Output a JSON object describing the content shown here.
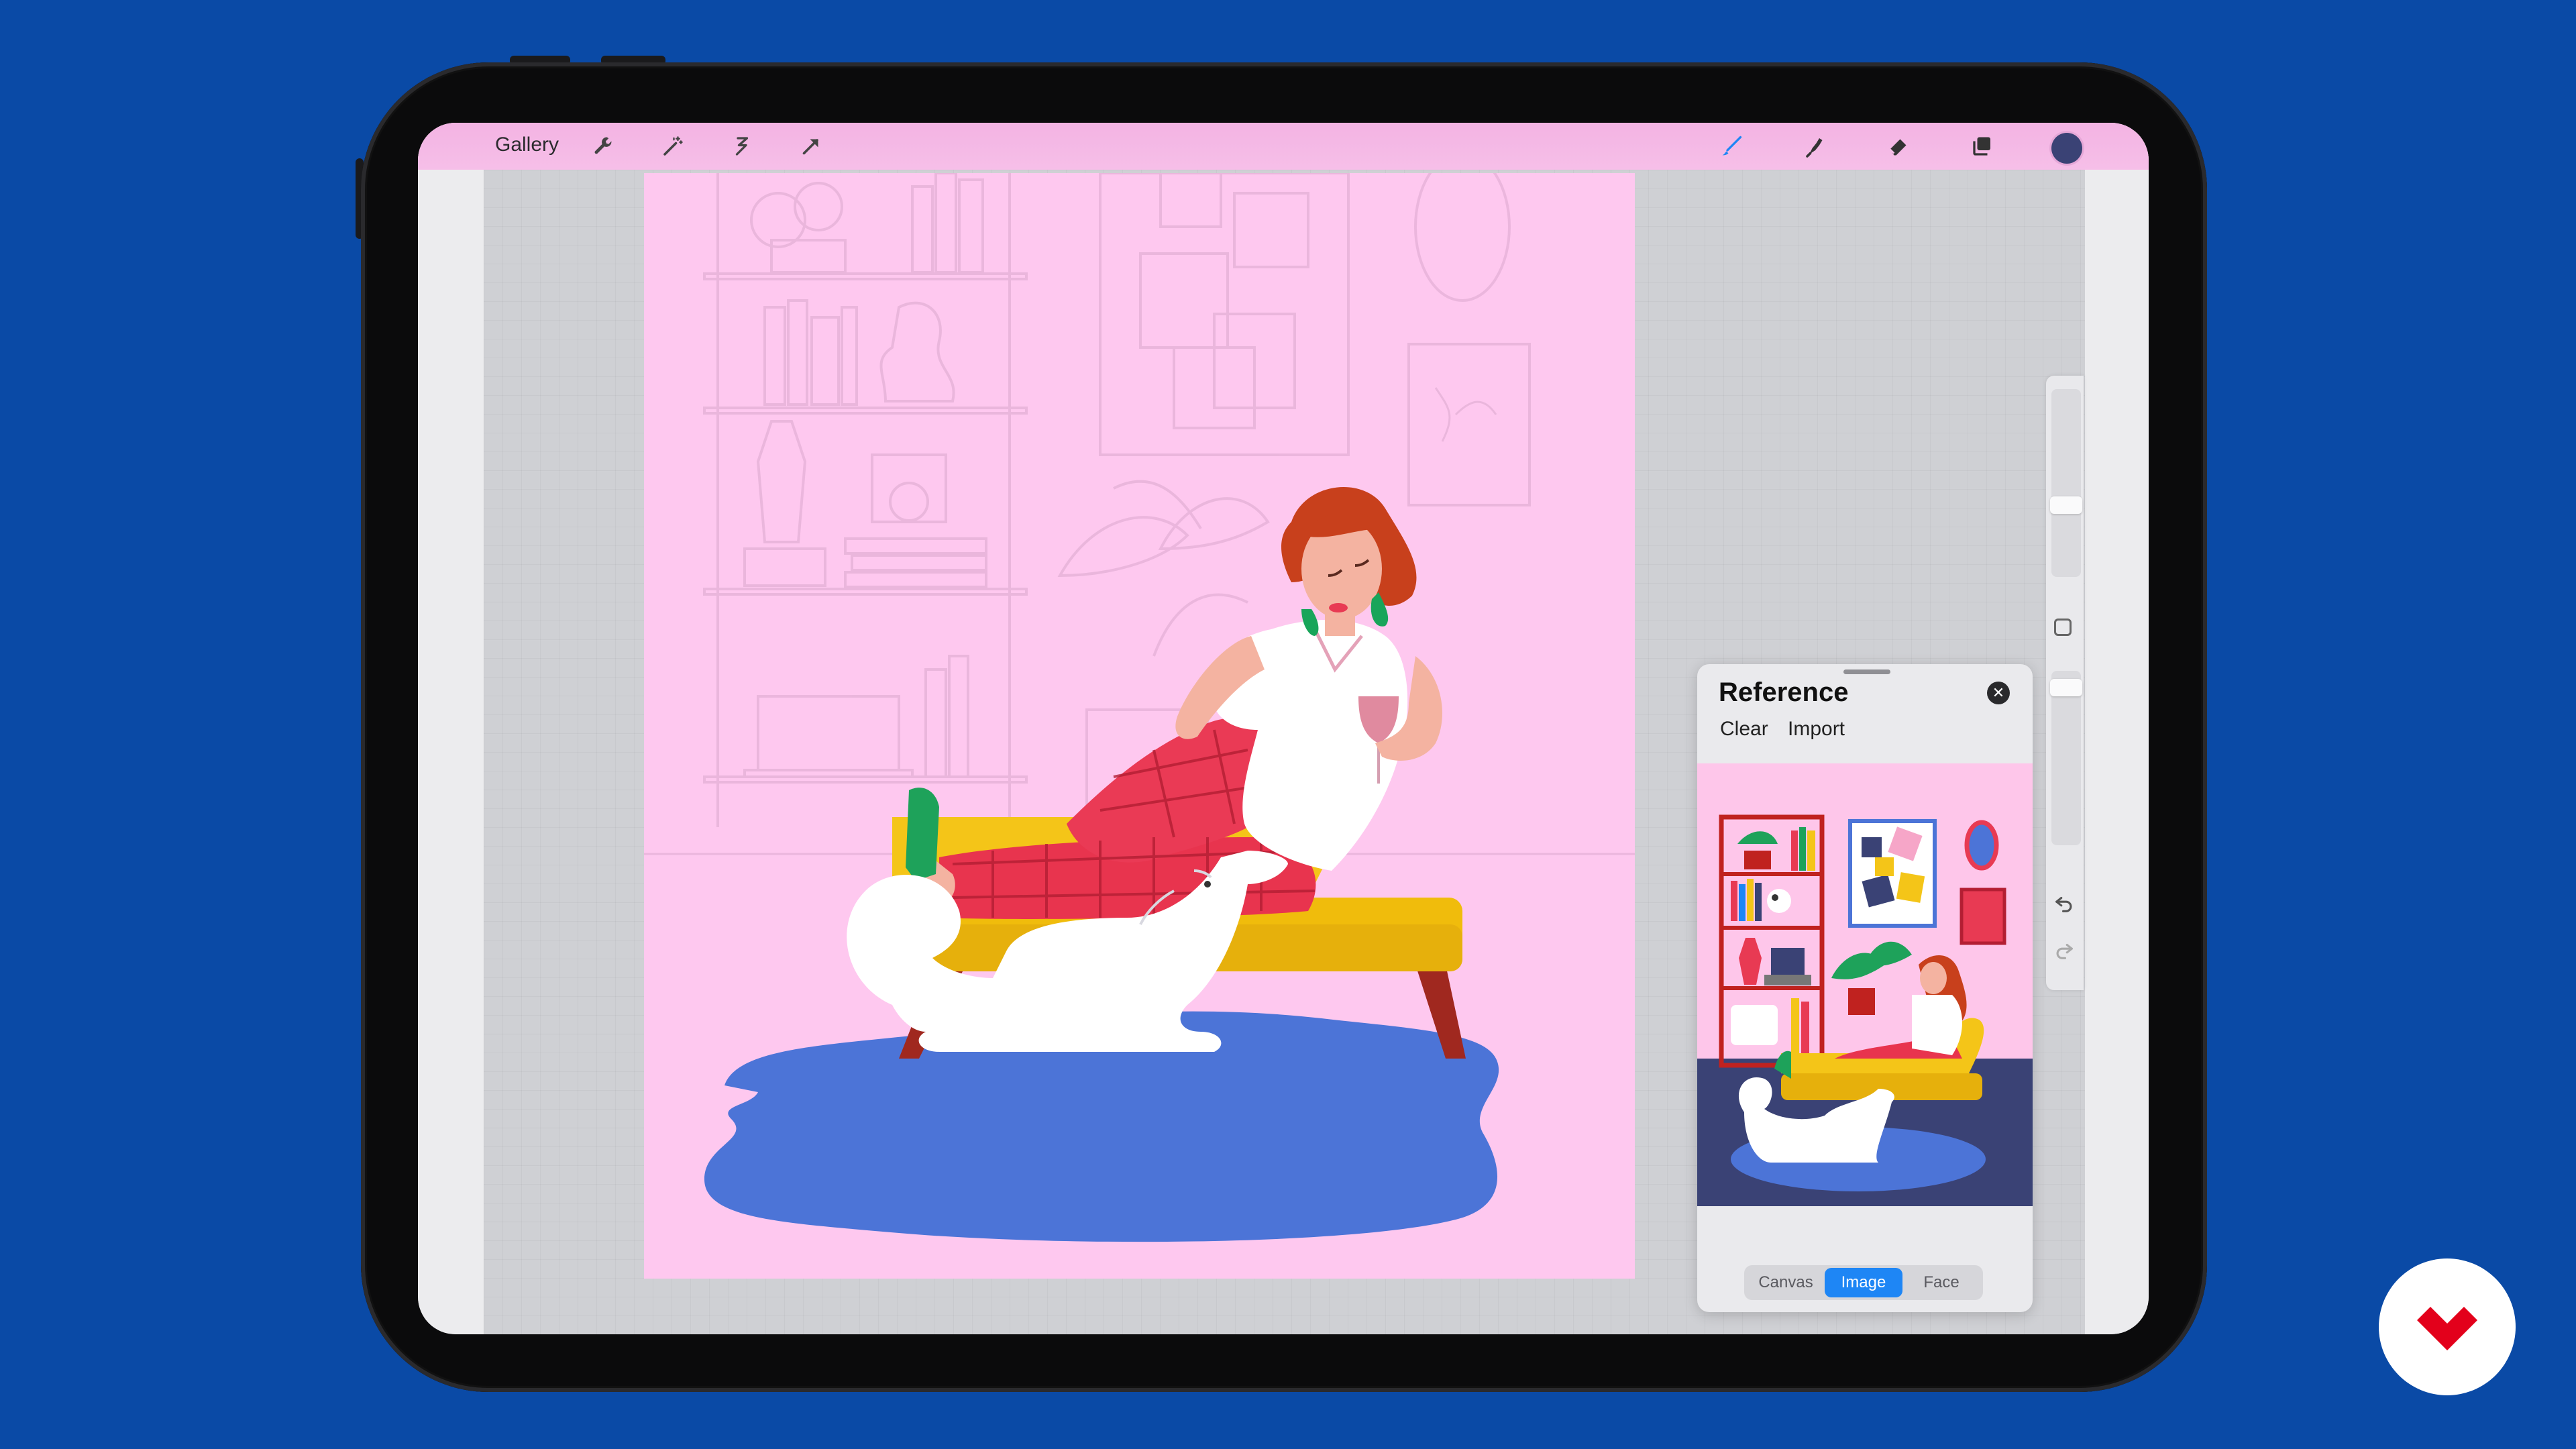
{
  "toolbar": {
    "gallery_label": "Gallery",
    "left_icons": [
      "wrench-icon",
      "magic-wand-icon",
      "selection-icon",
      "transform-arrow-icon"
    ],
    "right_icons": [
      "brush-icon",
      "smudge-icon",
      "eraser-icon",
      "layers-icon"
    ],
    "current_color": "#3a4275"
  },
  "reference": {
    "title": "Reference",
    "clear_label": "Clear",
    "import_label": "Import",
    "tabs": [
      {
        "label": "Canvas",
        "active": false
      },
      {
        "label": "Image",
        "active": true
      },
      {
        "label": "Face",
        "active": false
      }
    ]
  },
  "sidebar": {
    "icons": [
      "modify-square-icon",
      "undo-icon",
      "redo-icon"
    ]
  },
  "brand": {
    "logo_icon": "domestika-logo-icon",
    "logo_color": "#e3001b"
  },
  "colors": {
    "background": "#0a4aa6",
    "canvas_pink": "#fec8ef",
    "accent_blue": "#1e86f5"
  }
}
